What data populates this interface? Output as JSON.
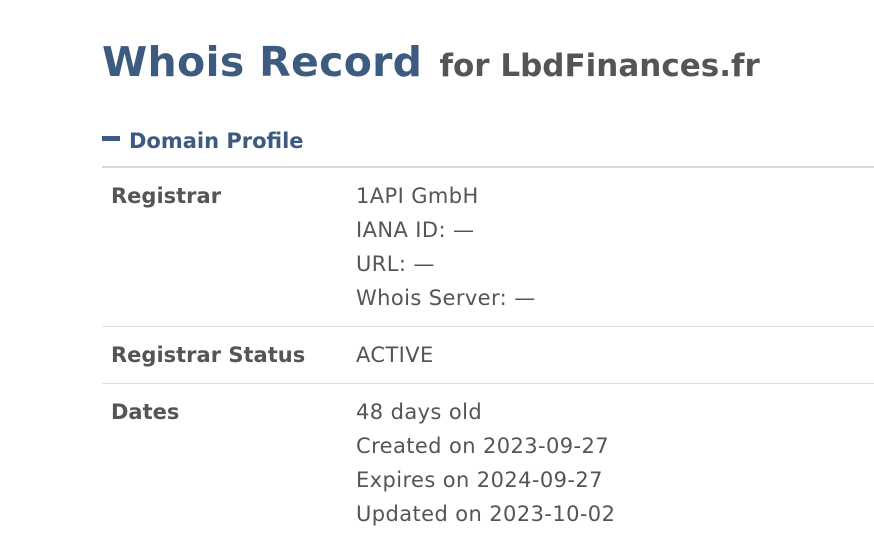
{
  "heading": {
    "title": "Whois Record",
    "subtitle": "for LbdFinances.fr"
  },
  "section": {
    "icon": "minus-icon",
    "title": "Domain Profile"
  },
  "rows": [
    {
      "label": "Registrar",
      "values": [
        "1API GmbH",
        "IANA ID: —",
        "URL: —",
        "Whois Server: —"
      ]
    },
    {
      "label": "Registrar Status",
      "values": [
        "ACTIVE"
      ]
    },
    {
      "label": "Dates",
      "values": [
        "48 days old",
        "Created on 2023-09-27",
        "Expires on 2024-09-27",
        "Updated on 2023-10-02"
      ]
    }
  ],
  "colors": {
    "accent": "#3d5a80",
    "text": "#555555",
    "rule": "#d9d9d9"
  }
}
